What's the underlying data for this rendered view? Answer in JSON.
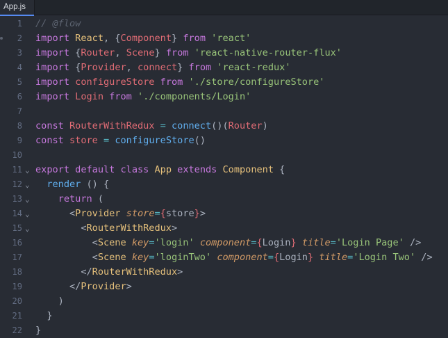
{
  "tab": {
    "label": "App.js"
  },
  "lines": [
    {
      "n": "1",
      "fold": "",
      "tokens": [
        [
          "cmt",
          "// @flow"
        ]
      ]
    },
    {
      "n": "2",
      "fold": "",
      "dot": true,
      "tokens": [
        [
          "kw",
          "import"
        ],
        [
          "pun",
          " "
        ],
        [
          "cl",
          "React"
        ],
        [
          "pun",
          ", {"
        ],
        [
          "var",
          "Component"
        ],
        [
          "pun",
          "} "
        ],
        [
          "kw",
          "from"
        ],
        [
          "pun",
          " "
        ],
        [
          "str",
          "'react'"
        ]
      ]
    },
    {
      "n": "3",
      "fold": "",
      "tokens": [
        [
          "kw",
          "import"
        ],
        [
          "pun",
          " {"
        ],
        [
          "var",
          "Router"
        ],
        [
          "pun",
          ", "
        ],
        [
          "var",
          "Scene"
        ],
        [
          "pun",
          "} "
        ],
        [
          "kw",
          "from"
        ],
        [
          "pun",
          " "
        ],
        [
          "str",
          "'react-native-router-flux'"
        ]
      ]
    },
    {
      "n": "4",
      "fold": "",
      "tokens": [
        [
          "kw",
          "import"
        ],
        [
          "pun",
          " {"
        ],
        [
          "var",
          "Provider"
        ],
        [
          "pun",
          ", "
        ],
        [
          "var",
          "connect"
        ],
        [
          "pun",
          "} "
        ],
        [
          "kw",
          "from"
        ],
        [
          "pun",
          " "
        ],
        [
          "str",
          "'react-redux'"
        ]
      ]
    },
    {
      "n": "5",
      "fold": "",
      "tokens": [
        [
          "kw",
          "import"
        ],
        [
          "pun",
          " "
        ],
        [
          "var",
          "configureStore"
        ],
        [
          "pun",
          " "
        ],
        [
          "kw",
          "from"
        ],
        [
          "pun",
          " "
        ],
        [
          "str",
          "'./store/configureStore'"
        ]
      ]
    },
    {
      "n": "6",
      "fold": "",
      "tokens": [
        [
          "kw",
          "import"
        ],
        [
          "pun",
          " "
        ],
        [
          "var",
          "Login"
        ],
        [
          "pun",
          " "
        ],
        [
          "kw",
          "from"
        ],
        [
          "pun",
          " "
        ],
        [
          "str",
          "'./components/Login'"
        ]
      ]
    },
    {
      "n": "7",
      "fold": "",
      "tokens": []
    },
    {
      "n": "8",
      "fold": "",
      "tokens": [
        [
          "kw",
          "const"
        ],
        [
          "pun",
          " "
        ],
        [
          "var",
          "RouterWithRedux"
        ],
        [
          "pun",
          " "
        ],
        [
          "op",
          "="
        ],
        [
          "pun",
          " "
        ],
        [
          "fn",
          "connect"
        ],
        [
          "pun",
          "()("
        ],
        [
          "var",
          "Router"
        ],
        [
          "pun",
          ")"
        ]
      ]
    },
    {
      "n": "9",
      "fold": "",
      "tokens": [
        [
          "kw",
          "const"
        ],
        [
          "pun",
          " "
        ],
        [
          "var",
          "store"
        ],
        [
          "pun",
          " "
        ],
        [
          "op",
          "="
        ],
        [
          "pun",
          " "
        ],
        [
          "fn",
          "configureStore"
        ],
        [
          "pun",
          "()"
        ]
      ]
    },
    {
      "n": "10",
      "fold": "",
      "tokens": []
    },
    {
      "n": "11",
      "fold": "⌄",
      "tokens": [
        [
          "kw",
          "export"
        ],
        [
          "pun",
          " "
        ],
        [
          "kw",
          "default"
        ],
        [
          "pun",
          " "
        ],
        [
          "kw",
          "class"
        ],
        [
          "pun",
          " "
        ],
        [
          "cl",
          "App"
        ],
        [
          "pun",
          " "
        ],
        [
          "kw",
          "extends"
        ],
        [
          "pun",
          " "
        ],
        [
          "cl",
          "Component"
        ],
        [
          "pun",
          " {"
        ]
      ]
    },
    {
      "n": "12",
      "fold": "⌄",
      "tokens": [
        [
          "pun",
          "  "
        ],
        [
          "fn",
          "render"
        ],
        [
          "pun",
          " () {"
        ]
      ]
    },
    {
      "n": "13",
      "fold": "⌄",
      "tokens": [
        [
          "pun",
          "    "
        ],
        [
          "kw",
          "return"
        ],
        [
          "pun",
          " ("
        ]
      ]
    },
    {
      "n": "14",
      "fold": "⌄",
      "tokens": [
        [
          "pun",
          "      <"
        ],
        [
          "tag",
          "Provider"
        ],
        [
          "pun",
          " "
        ],
        [
          "attr",
          "store"
        ],
        [
          "op",
          "="
        ],
        [
          "var",
          "{"
        ],
        [
          "pun",
          "store"
        ],
        [
          "var",
          "}"
        ],
        [
          "pun",
          ">"
        ]
      ]
    },
    {
      "n": "15",
      "fold": "⌄",
      "tokens": [
        [
          "pun",
          "        <"
        ],
        [
          "tag",
          "RouterWithRedux"
        ],
        [
          "pun",
          ">"
        ]
      ]
    },
    {
      "n": "16",
      "fold": "",
      "tokens": [
        [
          "pun",
          "          <"
        ],
        [
          "tag",
          "Scene"
        ],
        [
          "pun",
          " "
        ],
        [
          "attr",
          "key"
        ],
        [
          "op",
          "="
        ],
        [
          "str",
          "'login'"
        ],
        [
          "pun",
          " "
        ],
        [
          "attr",
          "component"
        ],
        [
          "op",
          "="
        ],
        [
          "var",
          "{"
        ],
        [
          "pun",
          "Login"
        ],
        [
          "var",
          "}"
        ],
        [
          "pun",
          " "
        ],
        [
          "attr",
          "title"
        ],
        [
          "op",
          "="
        ],
        [
          "str",
          "'Login Page'"
        ],
        [
          "pun",
          " />"
        ]
      ]
    },
    {
      "n": "17",
      "fold": "",
      "tokens": [
        [
          "pun",
          "          <"
        ],
        [
          "tag",
          "Scene"
        ],
        [
          "pun",
          " "
        ],
        [
          "attr",
          "key"
        ],
        [
          "op",
          "="
        ],
        [
          "str",
          "'loginTwo'"
        ],
        [
          "pun",
          " "
        ],
        [
          "attr",
          "component"
        ],
        [
          "op",
          "="
        ],
        [
          "var",
          "{"
        ],
        [
          "pun",
          "Login"
        ],
        [
          "var",
          "}"
        ],
        [
          "pun",
          " "
        ],
        [
          "attr",
          "title"
        ],
        [
          "op",
          "="
        ],
        [
          "str",
          "'Login Two'"
        ],
        [
          "pun",
          " />"
        ]
      ]
    },
    {
      "n": "18",
      "fold": "",
      "tokens": [
        [
          "pun",
          "        </"
        ],
        [
          "tag",
          "RouterWithRedux"
        ],
        [
          "pun",
          ">"
        ]
      ]
    },
    {
      "n": "19",
      "fold": "",
      "tokens": [
        [
          "pun",
          "      </"
        ],
        [
          "tag",
          "Provider"
        ],
        [
          "pun",
          ">"
        ]
      ]
    },
    {
      "n": "20",
      "fold": "",
      "tokens": [
        [
          "pun",
          "    )"
        ]
      ]
    },
    {
      "n": "21",
      "fold": "",
      "tokens": [
        [
          "pun",
          "  }"
        ]
      ]
    },
    {
      "n": "22",
      "fold": "",
      "tokens": [
        [
          "pun",
          "}"
        ]
      ]
    }
  ]
}
